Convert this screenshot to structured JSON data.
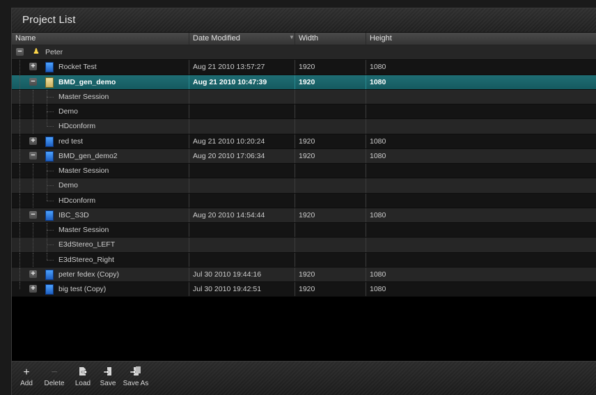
{
  "window": {
    "title": "Project List"
  },
  "columns": {
    "name": "Name",
    "date": "Date Modified",
    "width": "Width",
    "height": "Height"
  },
  "user": {
    "name": "Peter"
  },
  "rows": [
    {
      "label": "Rocket Test",
      "date": "Aug 21 2010 13:57:27",
      "w": "1920",
      "h": "1080"
    },
    {
      "label": "BMD_gen_demo",
      "date": "Aug 21 2010 10:47:39",
      "w": "1920",
      "h": "1080"
    },
    {
      "label": "Master Session",
      "date": "",
      "w": "",
      "h": ""
    },
    {
      "label": "Demo",
      "date": "",
      "w": "",
      "h": ""
    },
    {
      "label": "HDconform",
      "date": "",
      "w": "",
      "h": ""
    },
    {
      "label": "red test",
      "date": "Aug 21 2010 10:20:24",
      "w": "1920",
      "h": "1080"
    },
    {
      "label": "BMD_gen_demo2",
      "date": "Aug 20 2010 17:06:34",
      "w": "1920",
      "h": "1080"
    },
    {
      "label": "Master Session",
      "date": "",
      "w": "",
      "h": ""
    },
    {
      "label": "Demo",
      "date": "",
      "w": "",
      "h": ""
    },
    {
      "label": "HDconform",
      "date": "",
      "w": "",
      "h": ""
    },
    {
      "label": "IBC_S3D",
      "date": "Aug 20 2010 14:54:44",
      "w": "1920",
      "h": "1080"
    },
    {
      "label": "Master Session",
      "date": "",
      "w": "",
      "h": ""
    },
    {
      "label": "E3dStereo_LEFT",
      "date": "",
      "w": "",
      "h": ""
    },
    {
      "label": "E3dStereo_Right",
      "date": "",
      "w": "",
      "h": ""
    },
    {
      "label": "peter fedex (Copy)",
      "date": "Jul 30 2010 19:44:16",
      "w": "1920",
      "h": "1080"
    },
    {
      "label": "big test (Copy)",
      "date": "Jul 30 2010 19:42:51",
      "w": "1920",
      "h": "1080"
    }
  ],
  "toolbar": {
    "add": "Add",
    "delete": "Delete",
    "load": "Load",
    "save": "Save",
    "save_as": "Save As"
  },
  "icons": {
    "add": "+",
    "delete": "−",
    "load": "load-icon",
    "save": "save-icon",
    "save_as": "save-as-icon"
  },
  "colors": {
    "selection": "#1f6e74",
    "project_icon": "#3a8cf0"
  }
}
